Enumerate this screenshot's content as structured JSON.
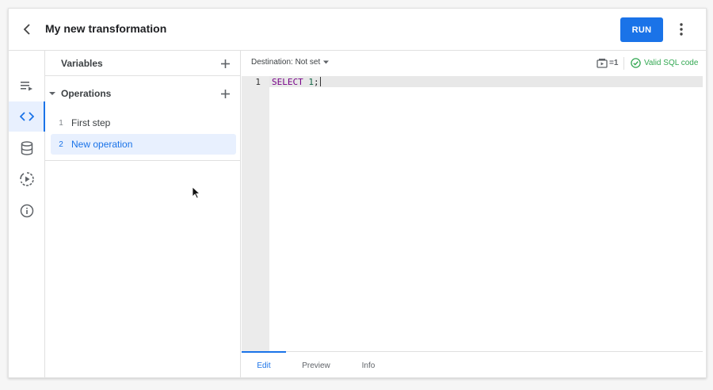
{
  "header": {
    "title": "My new transformation",
    "run_label": "RUN"
  },
  "rail": {
    "items": [
      {
        "icon": "playlist-play-icon"
      },
      {
        "icon": "code-icon",
        "active": true
      },
      {
        "icon": "database-icon"
      },
      {
        "icon": "history-play-icon"
      },
      {
        "icon": "info-icon"
      }
    ]
  },
  "panel": {
    "variables_title": "Variables",
    "operations_title": "Operations",
    "operations": [
      {
        "num": "1",
        "label": "First step",
        "selected": false
      },
      {
        "num": "2",
        "label": "New operation",
        "selected": true
      }
    ]
  },
  "toolbar": {
    "destination": "Destination: Not set",
    "params_count": "=1",
    "valid_text": "Valid SQL code"
  },
  "editor": {
    "line_number": "1",
    "keyword": "SELECT",
    "number": "1",
    "punct": ";"
  },
  "tabs": [
    {
      "label": "Edit",
      "active": true
    },
    {
      "label": "Preview",
      "active": false
    },
    {
      "label": "Info",
      "active": false
    }
  ],
  "colors": {
    "accent": "#1a73e8",
    "valid": "#34a853",
    "keyword": "#770088",
    "number": "#116644"
  }
}
